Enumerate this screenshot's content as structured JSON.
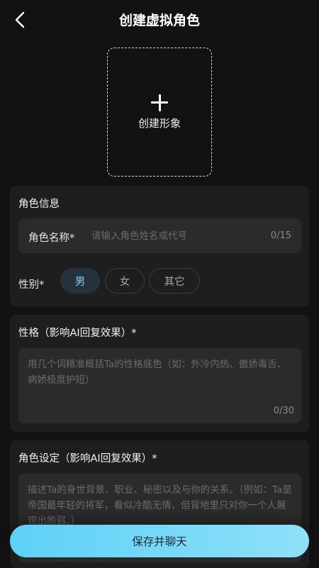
{
  "header": {
    "title": "创建虚拟角色"
  },
  "avatar_upload": {
    "label": "创建形象"
  },
  "role_info": {
    "section_title": "角色信息",
    "name_label": "角色名称*",
    "name_placeholder": "请输入角色姓名或代号",
    "name_count": "0/15",
    "gender_label": "性别*",
    "gender_options": [
      "男",
      "女",
      "其它"
    ],
    "gender_selected": "男"
  },
  "personality": {
    "section_title": "性格（影响AI回复效果）*",
    "placeholder": "用几个词精准概括Ta的性格底色（如：外冷内热、傲娇毒舌、病娇极度护短）",
    "count": "0/30"
  },
  "role_setting": {
    "section_title": "角色设定（影响AI回复效果）*",
    "placeholder": "描述Ta的身世背景、职业、秘密以及与你的关系。（例如：Ta是帝国最年轻的将军，看似冷酷无情，但背地里只对你一个人展现出脆弱。）"
  },
  "footer": {
    "save_label": "保存并聊天"
  },
  "colors": {
    "background": "#121212",
    "card": "#1e1e1e",
    "input": "#2b2b2b",
    "accent": "#7fd3f4",
    "button_gradient_start": "#5ed1f7",
    "button_gradient_end": "#8ee0f8"
  }
}
